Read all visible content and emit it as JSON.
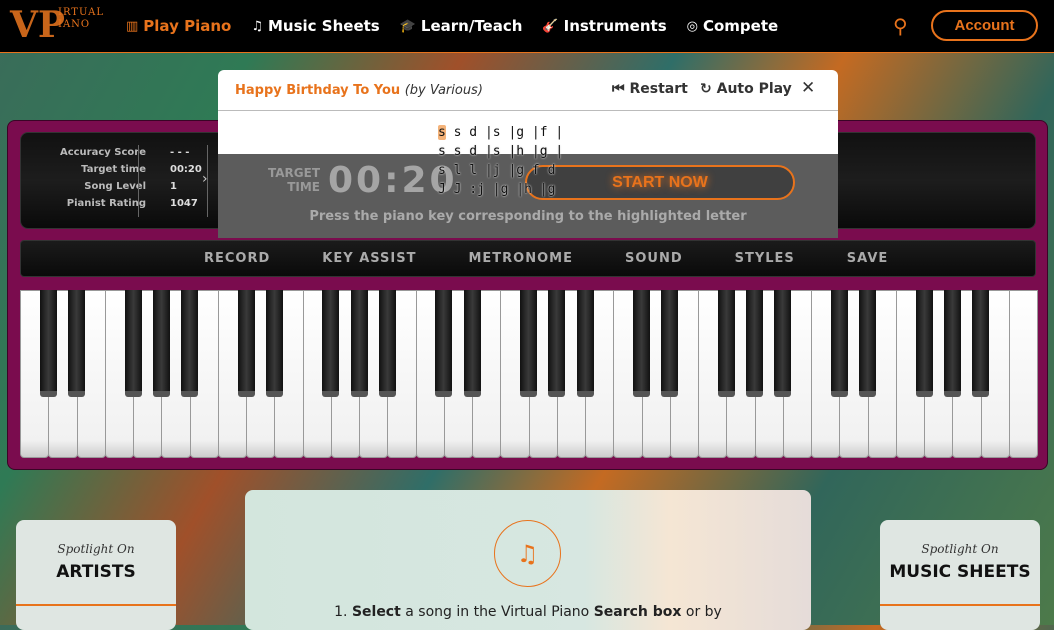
{
  "brand": {
    "logo_text_top": "IRTUAL",
    "logo_text_bottom": "IANO",
    "logo_letter": "V"
  },
  "nav": {
    "items": [
      {
        "label": "Play Piano",
        "icon": "piano-keys-icon",
        "glyph": "▥",
        "active": true
      },
      {
        "label": "Music Sheets",
        "icon": "music-notes-icon",
        "glyph": "♫"
      },
      {
        "label": "Learn/Teach",
        "icon": "graduation-cap-icon",
        "glyph": "🎓"
      },
      {
        "label": "Instruments",
        "icon": "guitar-icon",
        "glyph": "🎸"
      },
      {
        "label": "Compete",
        "icon": "target-icon",
        "glyph": "◎"
      }
    ],
    "account_label": "Account"
  },
  "colors": {
    "accent": "#e8731c",
    "frame": "#7a0c4e"
  },
  "stats": {
    "rows": [
      {
        "label": "Accuracy Score",
        "value": "- - -"
      },
      {
        "label": "Target time",
        "value": "00:20"
      },
      {
        "label": "Song Level",
        "value": "1"
      },
      {
        "label": "Pianist Rating",
        "value": "1047"
      }
    ]
  },
  "controls": [
    "RECORD",
    "KEY ASSIST",
    "METRONOME",
    "SOUND",
    "STYLES",
    "SAVE"
  ],
  "dialog": {
    "song_title": "Happy Birthday To You",
    "artist": "(by Various)",
    "restart_label": "Restart",
    "autoplay_label": "Auto Play",
    "highlighted": "s",
    "sheet_rows": [
      " s d |s |g |f |",
      "s s d |s |h |g |",
      "s l l |j |g f d",
      "J J :j |g |h |g"
    ],
    "target_label_1": "TARGET",
    "target_label_2": "TIME",
    "target_time": "00:20",
    "start_label": "START NOW",
    "hint": "Press the piano key corresponding to the highlighted letter"
  },
  "spotlight_left": {
    "kicker": "Spotlight On",
    "title": "ARTISTS"
  },
  "spotlight_right": {
    "kicker": "Spotlight On",
    "title": "MUSIC SHEETS"
  },
  "instructions": {
    "prefix": "1. ",
    "bold1": "Select",
    "mid": " a song in the Virtual Piano ",
    "bold2": "Search box",
    "suffix": " or by"
  },
  "piano": {
    "white_keys": 36,
    "range": "C2-C7"
  }
}
